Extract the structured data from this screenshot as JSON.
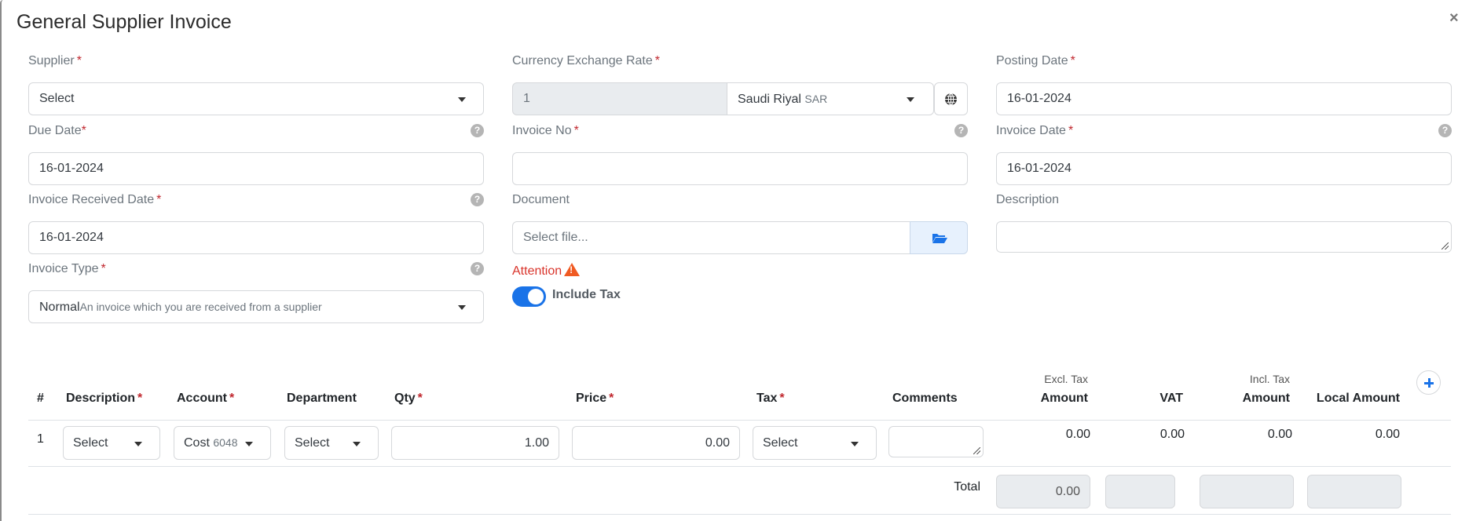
{
  "dialog": {
    "title": "General Supplier Invoice",
    "close_label": "×"
  },
  "form": {
    "supplier": {
      "label": "Supplier",
      "required": "*",
      "value": "Select"
    },
    "currency_exchange_rate": {
      "label": "Currency Exchange Rate",
      "required": "*",
      "rate_value": "1",
      "currency_name": "Saudi Riyal",
      "currency_code": "SAR"
    },
    "posting_date": {
      "label": "Posting Date",
      "required": "*",
      "value": "16-01-2024"
    },
    "due_date": {
      "label": "Due Date",
      "required": "*",
      "value": "16-01-2024",
      "help": "?"
    },
    "invoice_no": {
      "label": "Invoice No",
      "required": "*",
      "value": "",
      "help": "?"
    },
    "invoice_date": {
      "label": "Invoice Date",
      "required": "*",
      "value": "16-01-2024",
      "help": "?"
    },
    "invoice_received_date": {
      "label": "Invoice Received Date",
      "required": "*",
      "value": "16-01-2024",
      "help": "?"
    },
    "document": {
      "label": "Document",
      "placeholder": "Select file..."
    },
    "description": {
      "label": "Description",
      "value": ""
    },
    "invoice_type": {
      "label": "Invoice Type",
      "required": "*",
      "value": "Normal",
      "value_hint": "An invoice which you are received from a supplier",
      "help": "?"
    },
    "attention": {
      "label": "Attention"
    },
    "include_tax": {
      "label": "Include Tax",
      "enabled": true
    }
  },
  "table": {
    "headers": {
      "index": "#",
      "description": "Description",
      "account": "Account",
      "department": "Department",
      "qty": "Qty",
      "price": "Price",
      "tax": "Tax",
      "comments": "Comments",
      "excl_tax_sub": "Excl. Tax",
      "excl_tax_amount": "Amount",
      "vat": "VAT",
      "incl_tax_sub": "Incl. Tax",
      "incl_tax_amount": "Amount",
      "local_amount": "Local Amount",
      "required": "*"
    },
    "rows": [
      {
        "index": "1",
        "description": "Select",
        "account_name": "Cost",
        "account_code": "6048",
        "department": "Select",
        "qty": "1.00",
        "price": "0.00",
        "tax": "Select",
        "comments": "",
        "excl_tax_amount": "0.00",
        "vat": "0.00",
        "incl_tax_amount": "0.00",
        "local_amount": "0.00"
      }
    ],
    "total": {
      "label": "Total",
      "excl_tax_amount": "0.00",
      "vat": "",
      "incl_tax_amount": "",
      "local_amount": ""
    }
  },
  "colors": {
    "accent": "#1a73e8",
    "required": "#c0262d",
    "attention": "#d9342b",
    "warning_icon": "#f05a22",
    "readonly_bg": "#e9ecef",
    "file_button_bg": "#e7f1fd"
  }
}
